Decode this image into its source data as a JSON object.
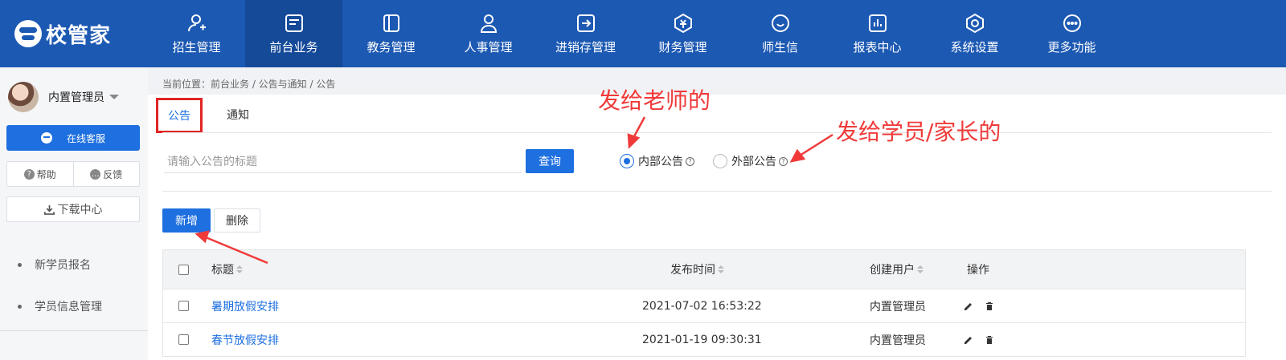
{
  "app": {
    "logo_text": "校管家"
  },
  "nav": {
    "items": [
      {
        "label": "招生管理",
        "icon": "person-add-icon"
      },
      {
        "label": "前台业务",
        "icon": "desk-icon",
        "active": true
      },
      {
        "label": "教务管理",
        "icon": "book-icon"
      },
      {
        "label": "人事管理",
        "icon": "person-icon"
      },
      {
        "label": "进销存管理",
        "icon": "inventory-icon"
      },
      {
        "label": "财务管理",
        "icon": "finance-icon"
      },
      {
        "label": "师生信",
        "icon": "message-icon"
      },
      {
        "label": "报表中心",
        "icon": "report-icon"
      },
      {
        "label": "系统设置",
        "icon": "settings-icon"
      },
      {
        "label": "更多功能",
        "icon": "more-icon"
      }
    ]
  },
  "sidebar": {
    "user_name": "内置管理员",
    "online_service": "在线客服",
    "help": "帮助",
    "feedback": "反馈",
    "download": "下载中心",
    "menu": [
      "新学员报名",
      "学员信息管理"
    ]
  },
  "breadcrumb": "当前位置：前台业务 / 公告与通知 / 公告",
  "tabs": {
    "announcement": "公告",
    "notice": "通知"
  },
  "search": {
    "placeholder": "请输入公告的标题",
    "button": "查询"
  },
  "radios": {
    "internal": "内部公告",
    "external": "外部公告"
  },
  "actions": {
    "add": "新增",
    "delete": "删除"
  },
  "table": {
    "headers": {
      "title": "标题",
      "time": "发布时间",
      "user": "创建用户",
      "ops": "操作"
    },
    "rows": [
      {
        "title": "暑期放假安排",
        "time": "2021-07-02 16:53:22",
        "user": "内置管理员"
      },
      {
        "title": "春节放假安排",
        "time": "2021-01-19 09:30:31",
        "user": "内置管理员"
      }
    ]
  },
  "annotations": {
    "teacher": "发给老师的",
    "student": "发给学员/家长的"
  },
  "colors": {
    "primary": "#1e6fe0",
    "header": "#1c59b3",
    "annotation": "#f03a3a"
  }
}
